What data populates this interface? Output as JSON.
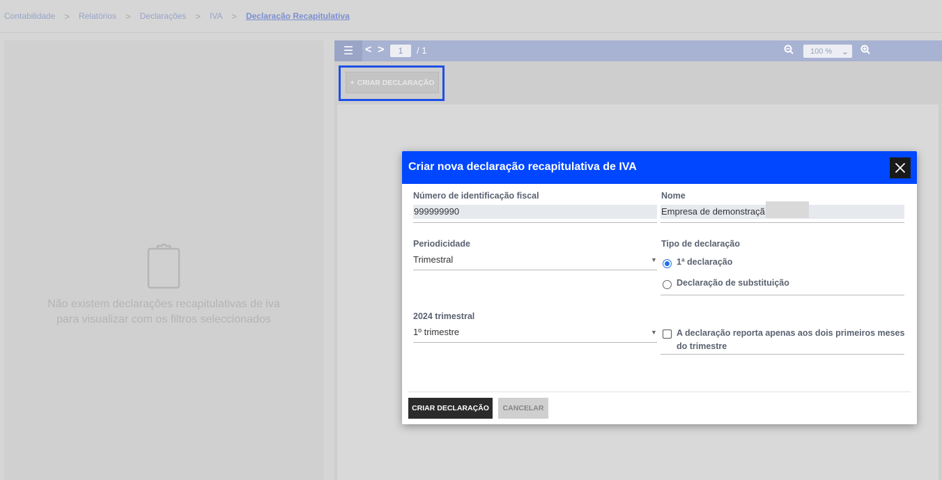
{
  "breadcrumb": {
    "items": [
      "Contabilidade",
      "Relatórios",
      "Declarações",
      "IVA"
    ],
    "current": "Declaração Recapitulativa"
  },
  "empty_state": {
    "icon": "clipboard-icon",
    "line1": "Não existem declarações recapitulativas de iva",
    "line2": "para visualizar com os filtros seleccionados"
  },
  "viewer": {
    "page_current": "1",
    "page_total": "/ 1",
    "zoom": "100 %",
    "create_button": "CRIAR DECLARAÇÃO"
  },
  "modal": {
    "title": "Criar nova declaração recapitulativa de IVA",
    "nif_label": "Número de identificação fiscal",
    "nif_value": "999999990",
    "name_label": "Nome",
    "name_value": "Empresa de demonstraçã",
    "periodicity_label": "Periodicidade",
    "periodicity_value": "Trimestral",
    "type_label": "Tipo de declaração",
    "type_options": [
      "1ª declaração",
      "Declaração de substituição"
    ],
    "type_selected": "1ª declaração",
    "quarter_label": "2024 trimestral",
    "quarter_value": "1º trimestre",
    "checkbox_line1": "A declaração reporta apenas aos dois primeiros meses",
    "checkbox_line2": "do trimestre",
    "checkbox_checked": false,
    "submit_label": "CRIAR DECLARAÇÃO",
    "cancel_label": "CANCELAR"
  },
  "colors": {
    "modal_header": "#0047ff",
    "highlight_frame": "#1e50e6",
    "radio_selected": "#1e6ff2"
  }
}
